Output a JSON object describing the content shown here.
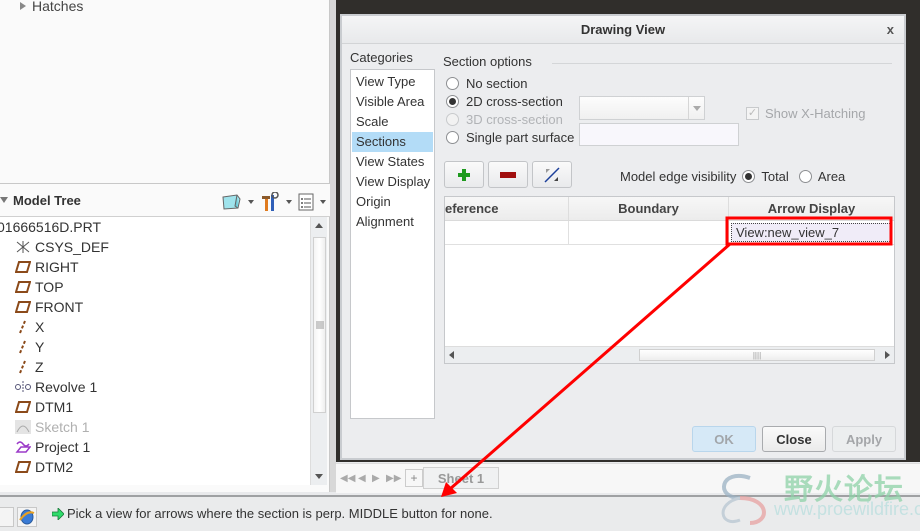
{
  "left_panel": {
    "layer_item": "Hatches",
    "model_tree": {
      "title": "Model Tree",
      "items": [
        {
          "label": "01666516D.PRT",
          "icon": "part-icon",
          "dim": false,
          "root": true
        },
        {
          "label": "CSYS_DEF",
          "icon": "csys-icon",
          "dim": false
        },
        {
          "label": "RIGHT",
          "icon": "datum-plane-icon",
          "dim": false
        },
        {
          "label": "TOP",
          "icon": "datum-plane-icon",
          "dim": false
        },
        {
          "label": "FRONT",
          "icon": "datum-plane-icon",
          "dim": false
        },
        {
          "label": "X",
          "icon": "datum-axis-icon",
          "dim": false
        },
        {
          "label": "Y",
          "icon": "datum-axis-icon",
          "dim": false
        },
        {
          "label": "Z",
          "icon": "datum-axis-icon",
          "dim": false
        },
        {
          "label": "Revolve 1",
          "icon": "revolve-icon",
          "dim": false
        },
        {
          "label": "DTM1",
          "icon": "datum-plane-icon",
          "dim": false
        },
        {
          "label": "Sketch 1",
          "icon": "sketch-icon",
          "dim": true
        },
        {
          "label": "Project 1",
          "icon": "project-icon",
          "dim": false
        },
        {
          "label": "DTM2",
          "icon": "datum-plane-icon",
          "dim": false
        }
      ]
    }
  },
  "dialog": {
    "title": "Drawing View",
    "close_glyph": "x",
    "categories_label": "Categories",
    "categories": [
      "View Type",
      "Visible Area",
      "Scale",
      "Sections",
      "View States",
      "View Display",
      "Origin",
      "Alignment"
    ],
    "selected_category": "Sections",
    "section_options_label": "Section options",
    "options": [
      {
        "label": "No section",
        "checked": false,
        "disabled": false
      },
      {
        "label": "2D cross-section",
        "checked": true,
        "disabled": false
      },
      {
        "label": "3D cross-section",
        "checked": false,
        "disabled": true
      },
      {
        "label": "Single part surface",
        "checked": false,
        "disabled": false
      }
    ],
    "show_x_hatching": {
      "label": "Show X-Hatching",
      "checked": true,
      "disabled": true
    },
    "model_edge_visibility": {
      "label": "Model edge visibility",
      "options": [
        {
          "label": "Total",
          "checked": true
        },
        {
          "label": "Area",
          "checked": false
        }
      ]
    },
    "table": {
      "columns": [
        "eference",
        "Boundary",
        "Arrow Display"
      ],
      "rows": [
        [
          "",
          "",
          "View:new_view_7"
        ]
      ]
    },
    "buttons": {
      "ok": "OK",
      "close": "Close",
      "apply": "Apply"
    }
  },
  "sheet_bar": {
    "add_glyph": "+",
    "sheet_tab": "Sheet 1"
  },
  "status": {
    "message": "Pick a view for arrows where the section is perp. MIDDLE button for none."
  },
  "watermark": {
    "chinese": "野火论坛",
    "url": "www.proewildfire.cn"
  },
  "colors": {
    "highlight_red": "#ff0000",
    "selection_blue": "#b3dcf7",
    "graphics_bg": "#302e2b"
  }
}
